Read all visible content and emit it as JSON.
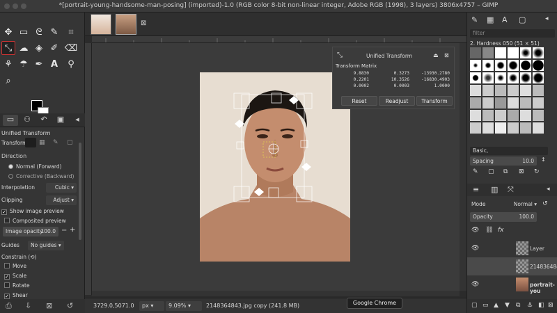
{
  "window": {
    "title": "*[portrait-young-handsome-man-posing] (imported)-1.0 (RGB color 8-bit non-linear integer, Adobe RGB (1998), 3 layers) 3806x4757 – GIMP"
  },
  "tool_options": {
    "title": "Unified Transform",
    "transform_label": "Transform:",
    "direction_label": "Direction",
    "direction_options": [
      "Normal (Forward)",
      "Corrective (Backward)"
    ],
    "interpolation_label": "Interpolation",
    "interpolation_value": "Cubic",
    "clipping_label": "Clipping",
    "clipping_value": "Adjust",
    "show_preview_label": "Show image preview",
    "composited_preview_label": "Composited preview",
    "image_opacity_label": "Image opacity",
    "image_opacity_value": "100.0",
    "guides_label": "Guides",
    "guides_value": "No guides",
    "constrain_label": "Constrain",
    "constrain_items": [
      "Move",
      "Scale",
      "Rotate",
      "Shear"
    ]
  },
  "transform_dialog": {
    "title": "Unified Transform",
    "matrix_label": "Transform Matrix",
    "matrix": [
      [
        "9.8830",
        "0.3273",
        "-13930.2780"
      ],
      [
        "0.2201",
        "10.3526",
        "-16830.4903"
      ],
      [
        "0.0002",
        "0.0003",
        "1.0000"
      ]
    ],
    "buttons": [
      "Reset",
      "Readjust",
      "Transform"
    ]
  },
  "statusbar": {
    "coords": "3729.0,5071.0",
    "unit": "px",
    "zoom": "9.09%",
    "info": "2148364843.jpg copy (241.8 MB)"
  },
  "tooltip": "Google Chrome",
  "brushes": {
    "filter_placeholder": "filter",
    "current_brush": "2. Hardness 050 (51 × 51)",
    "preset": "Basic,",
    "spacing_label": "Spacing",
    "spacing_value": "10.0"
  },
  "layers": {
    "mode_label": "Mode",
    "mode_value": "Normal",
    "opacity_label": "Opacity",
    "opacity_value": "100.0",
    "items": [
      {
        "name": "Layer"
      },
      {
        "name": "214836484"
      },
      {
        "name": "portrait-you"
      }
    ]
  },
  "colors": {
    "accent": "#cc3333",
    "canvas": "#3b3b3b"
  }
}
